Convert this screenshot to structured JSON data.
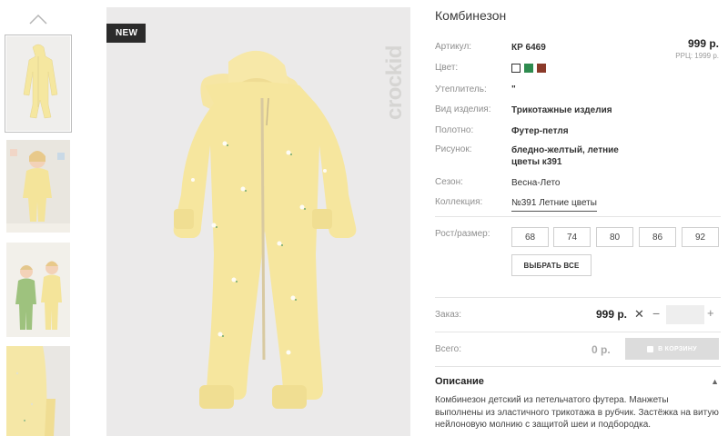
{
  "gallery": {
    "thumbnails": [
      {
        "name": "thumb-product-front",
        "kind": "product"
      },
      {
        "name": "thumb-child-standing",
        "kind": "photo"
      },
      {
        "name": "thumb-two-children",
        "kind": "photo"
      },
      {
        "name": "thumb-sleeve-closeup",
        "kind": "detail"
      }
    ],
    "badge": "NEW",
    "brand_mark": "crockid"
  },
  "product": {
    "title": "Комбинезон",
    "price": "999 р.",
    "rrc": "РРЦ: 1999 р.",
    "attributes": [
      {
        "label": "Артикул:",
        "value": "КР 6469"
      },
      {
        "label": "Цвет:",
        "value": ""
      },
      {
        "label": "Утеплитель:",
        "value": "\""
      },
      {
        "label": "Вид изделия:",
        "value": "Трикотажные изделия"
      },
      {
        "label": "Полотно:",
        "value": "Футер-петля"
      },
      {
        "label": "Рисунок:",
        "value": "бледно-желтый, летние цветы к391"
      },
      {
        "label": "Сезон:",
        "value": "Весна-Лето"
      },
      {
        "label": "Коллекция:",
        "value": "№391 Летние цветы"
      }
    ],
    "colors": [
      "#ffffff",
      "#2e8b4f",
      "#8b3a2a"
    ]
  },
  "sizes": {
    "label": "Рост/размер:",
    "options": [
      "68",
      "74",
      "80",
      "86",
      "92"
    ],
    "select_all": "ВЫБРАТЬ ВСЕ"
  },
  "order": {
    "label": "Заказ:",
    "price": "999 р.",
    "times": "✕",
    "minus": "−",
    "plus": "+",
    "quantity": ""
  },
  "total": {
    "label": "Всего:",
    "value": "0 р.",
    "cart_button": "В КОРЗИНУ"
  },
  "description": {
    "title": "Описание",
    "toggle": "▲",
    "text": "Комбинезон детский из петельчатого футера. Манжеты выполнены из эластичного трикотажа в рубчик. Застёжка на витую нейлоновую молнию с защитой шеи и подбородка."
  },
  "icons": {
    "scroll_up": "chevron-up-icon",
    "cart": "cart-icon"
  }
}
